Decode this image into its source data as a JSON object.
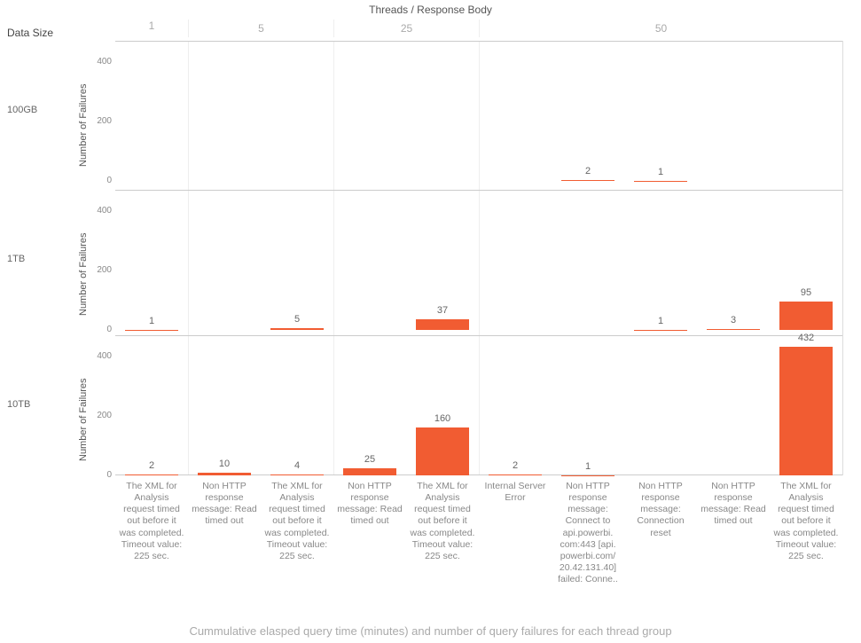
{
  "title_top": "Threads  /  Response Body",
  "corner_label": "Data Size",
  "caption": "Cummulative elasped query time (minutes) and number of query failures for each thread group",
  "ylabel": "Number of Failures",
  "y_ticks": [
    0,
    200,
    400
  ],
  "ylim": [
    0,
    470
  ],
  "row_labels": [
    "100GB",
    "1TB",
    "10TB"
  ],
  "thread_groups": [
    {
      "label": "1",
      "cols": [
        "c0"
      ]
    },
    {
      "label": "5",
      "cols": [
        "c1",
        "c2"
      ]
    },
    {
      "label": "25",
      "cols": [
        "c3",
        "c4"
      ]
    },
    {
      "label": "50",
      "cols": [
        "c5",
        "c6",
        "c7",
        "c8",
        "c9"
      ]
    }
  ],
  "columns": {
    "c0": "The XML for Analysis request timed out before it was completed. Timeout value: 225 sec.",
    "c1": "Non HTTP response message: Read timed out",
    "c2": "The XML for Analysis request timed out before it was completed. Timeout value: 225 sec.",
    "c3": "Non HTTP response message: Read timed out",
    "c4": "The XML for Analysis request timed out before it was completed. Timeout value: 225 sec.",
    "c5": "Internal Server Error",
    "c6": "Non HTTP response message: Connect to api.powerbi. com:443 [api. powerbi.com/ 20.42.131.40] failed: Conne..",
    "c7": "Non HTTP response message: Connection reset",
    "c8": "Non HTTP response message: Read timed out",
    "c9": "The XML for Analysis request timed out before it was completed. Timeout value: 225 sec."
  },
  "chart_data": {
    "type": "bar",
    "rows": {
      "100GB": {
        "c6": 2,
        "c7": 1
      },
      "1TB": {
        "c0": 1,
        "c2": 5,
        "c4": 37,
        "c7": 1,
        "c8": 3,
        "c9": 95
      },
      "10TB": {
        "c0": 2,
        "c1": 10,
        "c2": 4,
        "c3": 25,
        "c4": 160,
        "c5": 2,
        "c6": 1,
        "c9": 432
      }
    }
  }
}
